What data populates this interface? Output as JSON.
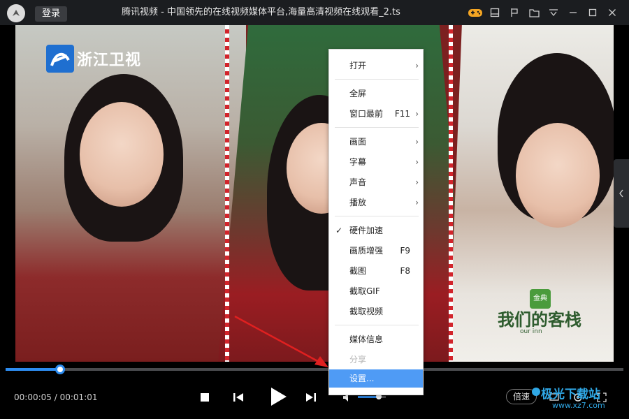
{
  "titlebar": {
    "login_label": "登录",
    "title": "腾讯视频 - 中国领先的在线视频媒体平台,海量高清视频在线观看_2.ts",
    "icons": [
      "gamepad-icon",
      "window-icon",
      "pin-icon",
      "folder-icon",
      "menu-icon",
      "minimize-icon",
      "maximize-icon",
      "close-icon"
    ]
  },
  "video": {
    "channel_name": "浙江卫视",
    "show_logo": "我们的客栈",
    "show_badge": "金典",
    "show_logo_sub": "our inn"
  },
  "playback": {
    "current_time": "00:00:05",
    "separator": "/",
    "total_time": "00:01:01",
    "progress_fraction": 0.088,
    "volume_fraction": 0.75,
    "speed_label": "倍速"
  },
  "watermark": {
    "text": "极光下载站",
    "url": "www.xz7.com"
  },
  "context_menu": {
    "items": [
      {
        "label": "打开",
        "shortcut": "",
        "submenu": true,
        "checked": false,
        "disabled": false,
        "active": false
      },
      {
        "label": "全屏",
        "shortcut": "",
        "submenu": false,
        "checked": false,
        "disabled": false,
        "active": false
      },
      {
        "label": "窗口最前",
        "shortcut": "F11",
        "submenu": true,
        "checked": false,
        "disabled": false,
        "active": false
      },
      {
        "label": "画面",
        "shortcut": "",
        "submenu": true,
        "checked": false,
        "disabled": false,
        "active": false
      },
      {
        "label": "字幕",
        "shortcut": "",
        "submenu": true,
        "checked": false,
        "disabled": false,
        "active": false
      },
      {
        "label": "声音",
        "shortcut": "",
        "submenu": true,
        "checked": false,
        "disabled": false,
        "active": false
      },
      {
        "label": "播放",
        "shortcut": "",
        "submenu": true,
        "checked": false,
        "disabled": false,
        "active": false
      },
      {
        "label": "硬件加速",
        "shortcut": "",
        "submenu": false,
        "checked": true,
        "disabled": false,
        "active": false
      },
      {
        "label": "画质增强",
        "shortcut": "F9",
        "submenu": false,
        "checked": false,
        "disabled": false,
        "active": false
      },
      {
        "label": "截图",
        "shortcut": "F8",
        "submenu": false,
        "checked": false,
        "disabled": false,
        "active": false
      },
      {
        "label": "截取GIF",
        "shortcut": "",
        "submenu": false,
        "checked": false,
        "disabled": false,
        "active": false
      },
      {
        "label": "截取视频",
        "shortcut": "",
        "submenu": false,
        "checked": false,
        "disabled": false,
        "active": false
      },
      {
        "label": "媒体信息",
        "shortcut": "",
        "submenu": false,
        "checked": false,
        "disabled": false,
        "active": false
      },
      {
        "label": "分享",
        "shortcut": "",
        "submenu": false,
        "checked": false,
        "disabled": true,
        "active": false
      },
      {
        "label": "设置...",
        "shortcut": "",
        "submenu": false,
        "checked": false,
        "disabled": false,
        "active": true
      }
    ]
  },
  "colors": {
    "accent": "#2d8cf0",
    "menu_highlight": "#4f9bf5",
    "annotation_arrow": "#e02020",
    "titlebar_bg": "#1b1d20"
  }
}
